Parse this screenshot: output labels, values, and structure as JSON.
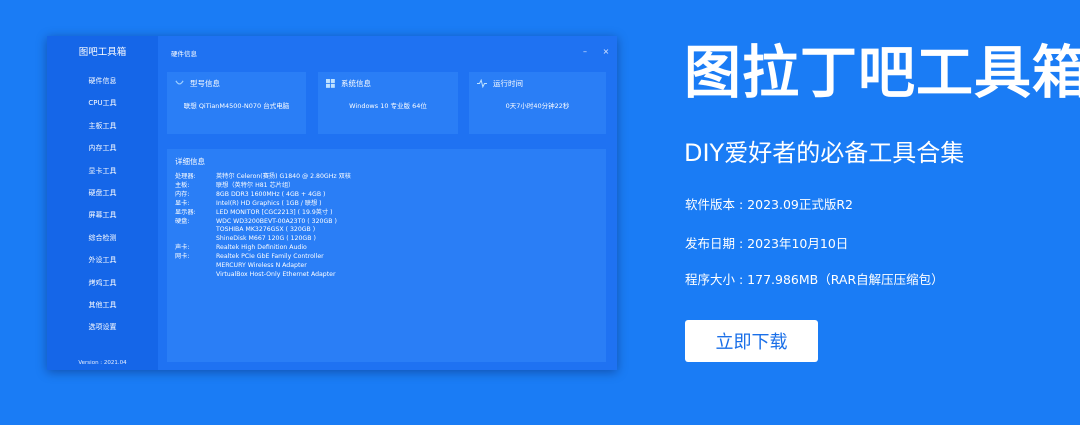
{
  "app": {
    "sidebar_title": "图吧工具箱",
    "window_title": "硬件信息",
    "version": "Version : 2021.04",
    "minimize": "–",
    "close": "×",
    "sidebar_items": [
      "硬件信息",
      "CPU工具",
      "主板工具",
      "内存工具",
      "显卡工具",
      "硬盘工具",
      "屏幕工具",
      "综合检测",
      "外设工具",
      "烤鸡工具",
      "其他工具",
      "选项设置"
    ],
    "cards": {
      "model": {
        "label": "型号信息",
        "value": "联想 QiTianM4500-N070 台式电脑"
      },
      "system": {
        "label": "系统信息",
        "value": "Windows 10 专业版 64位"
      },
      "uptime": {
        "label": "运行时间",
        "value": "0天7小时40分钟22秒"
      }
    },
    "detail": {
      "title": "详细信息",
      "rows": [
        {
          "k": "处理器:",
          "v": "英特尔 Celeron(赛扬) G1840 @ 2.80GHz 双核"
        },
        {
          "k": "主板:",
          "v": "联想（英特尔 H81 芯片组）"
        },
        {
          "k": "内存:",
          "v": "8GB DDR3 1600MHz ( 4GB + 4GB )"
        },
        {
          "k": "显卡:",
          "v": "Intel(R) HD Graphics ( 1GB / 联想 )"
        },
        {
          "k": "显示器:",
          "v": "LED MONITOR [CGC2213] ( 19.9英寸 )"
        },
        {
          "k": "硬盘:",
          "v": "WDC WD3200BEVT-00A23T0 ( 320GB )"
        },
        {
          "k": "",
          "v": "TOSHIBA MK3276GSX ( 320GB )"
        },
        {
          "k": "",
          "v": "ShineDisk M667 120G ( 120GB )"
        },
        {
          "k": "声卡:",
          "v": "Realtek High Definition Audio"
        },
        {
          "k": "网卡:",
          "v": "Realtek PCIe GbE Family Controller"
        },
        {
          "k": "",
          "v": "MERCURY Wireless N Adapter"
        },
        {
          "k": "",
          "v": "VirtualBox Host-Only Ethernet Adapter"
        }
      ]
    }
  },
  "promo": {
    "title": "图拉丁吧工具箱",
    "subtitle": "DIY爱好者的必备工具合集",
    "version_line": "软件版本 : 2023.09正式版R2",
    "date_line": "发布日期 : 2023年10月10日",
    "size_line": "程序大小 : 177.986MB（RAR自解压压缩包）",
    "download_label": "立即下载"
  },
  "colors": {
    "background": "#1a7cf5",
    "window": "#1f72f2",
    "sidebar": "#1566e8",
    "card": "#2a7ef6",
    "button_text": "#1a6fe8"
  },
  "icons": {
    "model": "monitor-icon",
    "system": "windows-icon",
    "uptime": "pulse-icon"
  }
}
